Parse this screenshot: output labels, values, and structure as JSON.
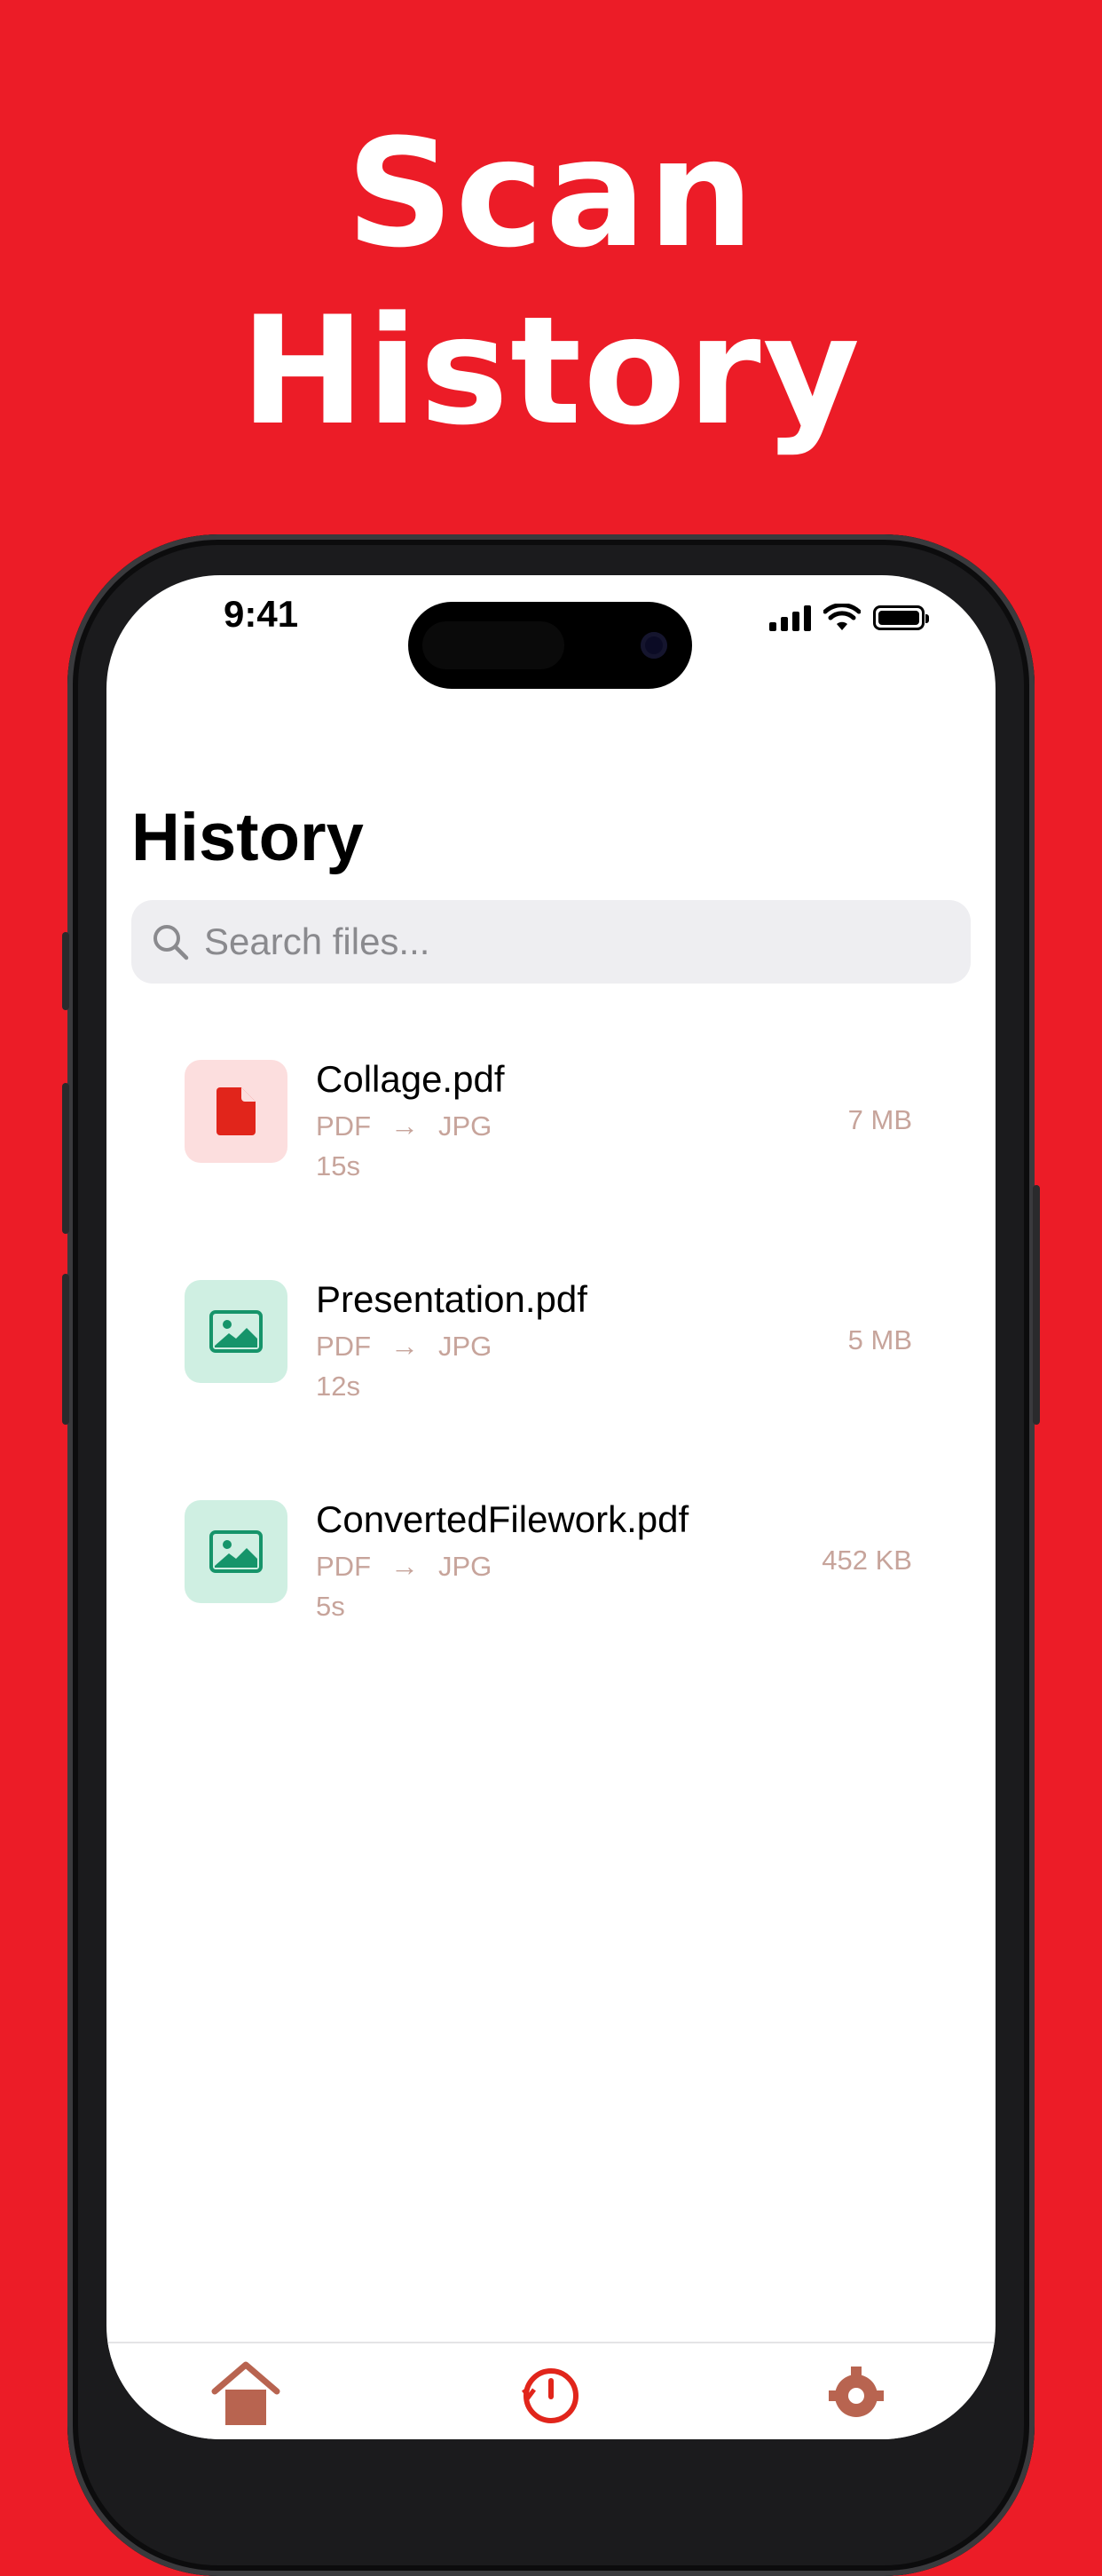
{
  "headline": {
    "line1": "Scan",
    "line2": "History"
  },
  "status_bar": {
    "time": "9:41"
  },
  "page": {
    "title": "History"
  },
  "search": {
    "placeholder": "Search files..."
  },
  "files": [
    {
      "name": "Collage.pdf",
      "from": "PDF",
      "to": "JPG",
      "duration": "15s",
      "size": "7 MB",
      "icon": "pdf-file-icon"
    },
    {
      "name": "Presentation.pdf",
      "from": "PDF",
      "to": "JPG",
      "duration": "12s",
      "size": "5 MB",
      "icon": "image-icon"
    },
    {
      "name": "ConvertedFilework.pdf",
      "from": "PDF",
      "to": "JPG",
      "duration": "5s",
      "size": "452 KB",
      "icon": "image-icon"
    }
  ],
  "tabbar": {
    "items": [
      "home-icon",
      "history-icon",
      "settings-icon"
    ]
  },
  "colors": {
    "background": "#EC1C27",
    "accent": "#E1251B",
    "image_green": "#16946A",
    "muted": "#C7A49B"
  }
}
